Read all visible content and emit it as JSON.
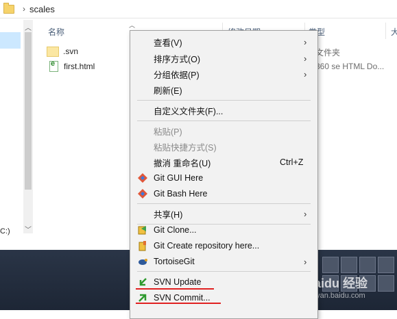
{
  "address": {
    "path": "scales",
    "separator": "›"
  },
  "nav": {
    "drive_label": "C:)"
  },
  "columns": {
    "name": "名称",
    "modified": "修改日期",
    "type": "类型",
    "size": "大"
  },
  "files": [
    {
      "name": ".svn",
      "type": "文件夹"
    },
    {
      "name": "first.html",
      "type": "360 se HTML Do..."
    }
  ],
  "menu": {
    "view": "查看(V)",
    "sort": "排序方式(O)",
    "group": "分组依据(P)",
    "refresh": "刷新(E)",
    "customize": "自定义文件夹(F)...",
    "paste": "粘贴(P)",
    "paste_shortcut": "粘贴快捷方式(S)",
    "undo": "撤消 重命名(U)",
    "undo_shortcut": "Ctrl+Z",
    "git_gui": "Git GUI Here",
    "git_bash": "Git Bash Here",
    "share": "共享(H)",
    "git_clone": "Git Clone...",
    "git_create": "Git Create repository here...",
    "tortoise_git": "TortoiseGit",
    "svn_update": "SVN Update",
    "svn_commit": "SVN Commit...",
    "arrow": "›"
  },
  "watermark": {
    "brand": "Baidu 经验",
    "url": "jingyan.baidu.com"
  },
  "colors": {
    "underline": "#e02020",
    "selection": "#cce8ff",
    "menu_bg": "#f2f2f2"
  }
}
